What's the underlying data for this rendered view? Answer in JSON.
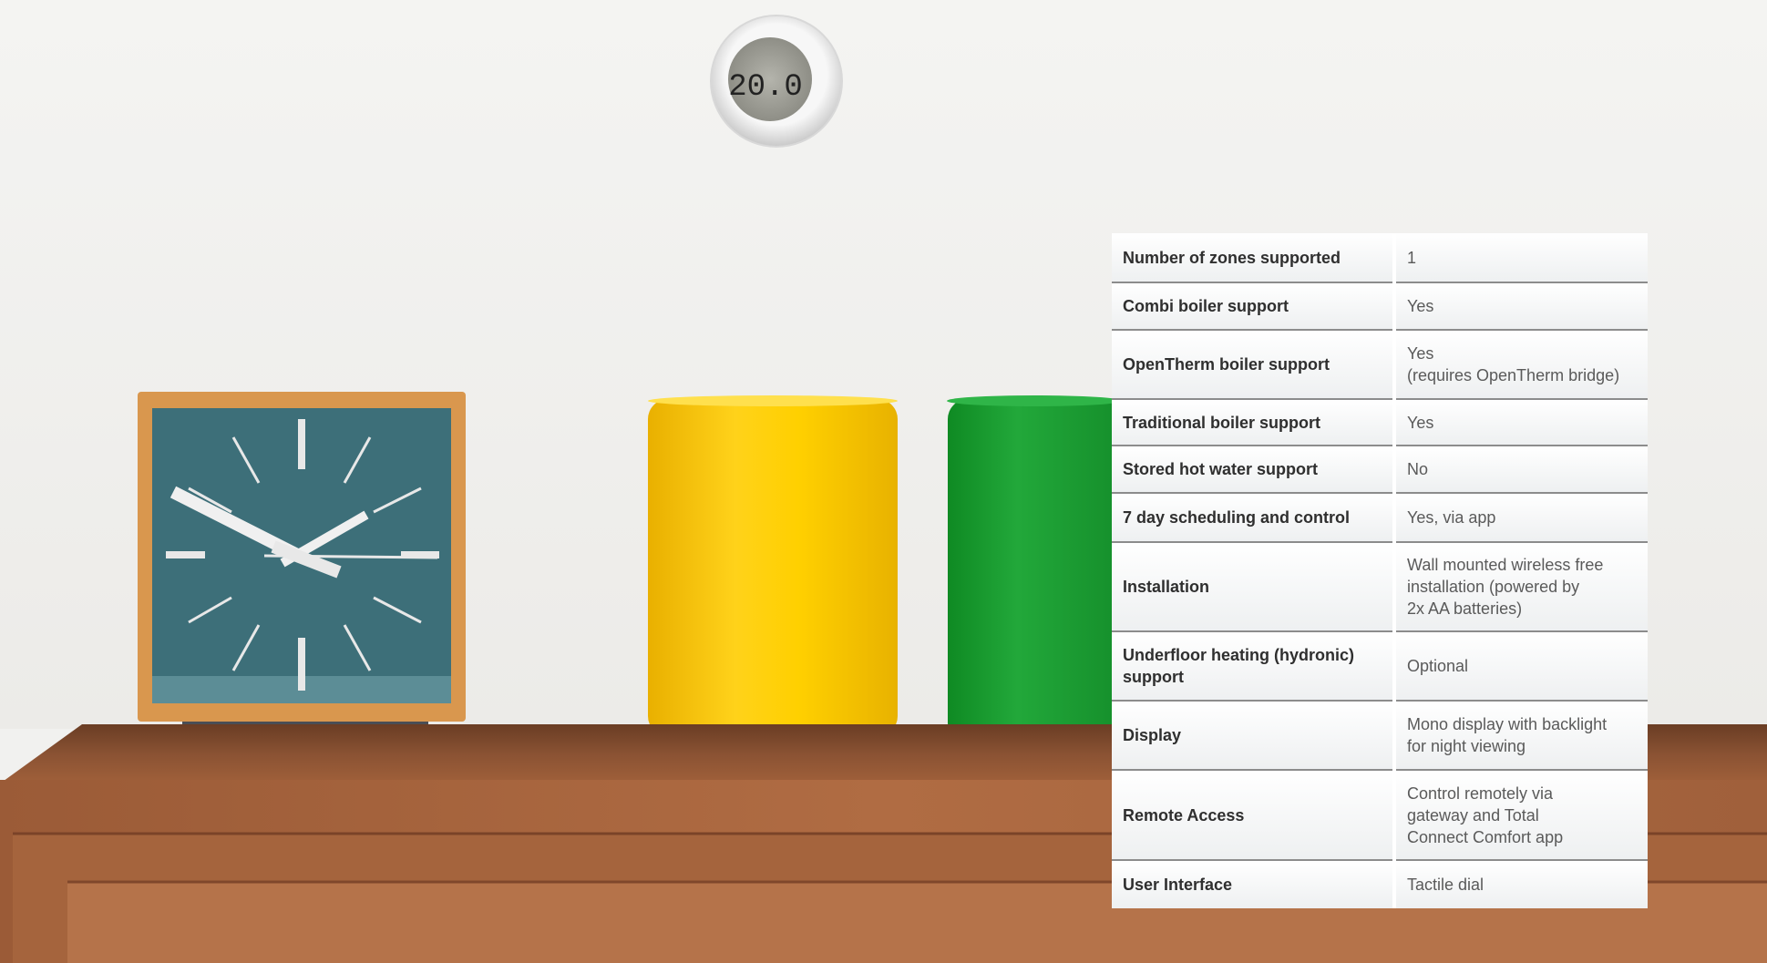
{
  "thermostat": {
    "display_reading": "20.0"
  },
  "spec_table": {
    "rows": [
      {
        "label": "Number of zones supported",
        "value": "1"
      },
      {
        "label": "Combi boiler support",
        "value": "Yes"
      },
      {
        "label": "OpenTherm boiler support",
        "value": "Yes\n(requires OpenTherm bridge)"
      },
      {
        "label": "Traditional boiler support",
        "value": "Yes"
      },
      {
        "label": "Stored hot water support",
        "value": "No"
      },
      {
        "label": "7 day scheduling and control",
        "value": "Yes, via app"
      },
      {
        "label": "Installation",
        "value": "Wall mounted wireless free\ninstallation (powered by\n2x AA batteries)"
      },
      {
        "label": "Underfloor heating (hydronic)\nsupport",
        "value": "Optional"
      },
      {
        "label": "Display",
        "value": "Mono display with backlight\nfor night viewing"
      },
      {
        "label": "Remote Access",
        "value": "Control remotely via\ngateway and Total\nConnect Comfort app"
      },
      {
        "label": "User Interface",
        "value": "Tactile dial"
      }
    ]
  }
}
